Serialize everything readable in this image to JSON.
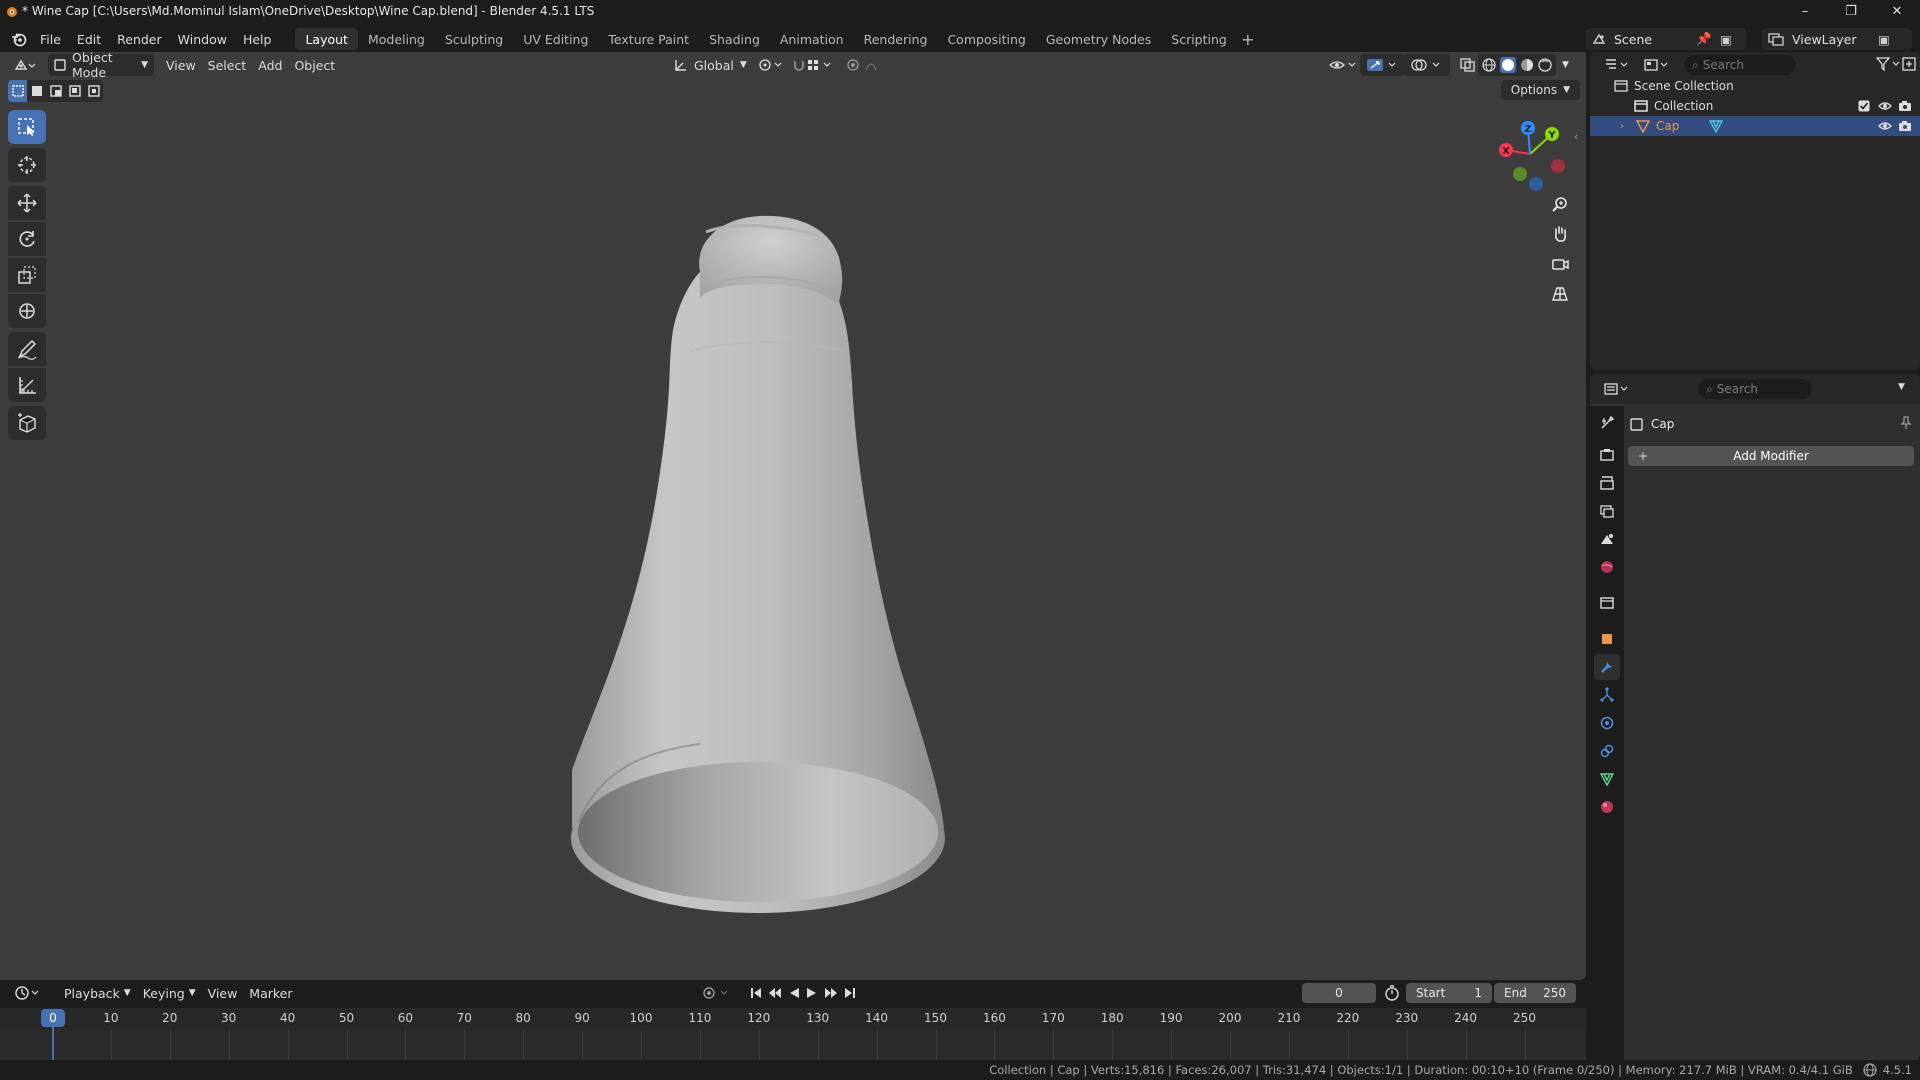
{
  "window": {
    "title": "* Wine Cap [C:\\Users\\Md.Mominul Islam\\OneDrive\\Desktop\\Wine Cap.blend] - Blender 4.5.1 LTS",
    "controls": [
      "–",
      "❐",
      "✕"
    ]
  },
  "menus": [
    "File",
    "Edit",
    "Render",
    "Window",
    "Help"
  ],
  "workspaces": {
    "tabs": [
      "Layout",
      "Modeling",
      "Sculpting",
      "UV Editing",
      "Texture Paint",
      "Shading",
      "Animation",
      "Rendering",
      "Compositing",
      "Geometry Nodes",
      "Scripting"
    ],
    "active": "Layout",
    "add": "+"
  },
  "scene": {
    "name": "Scene",
    "view_layer": "ViewLayer"
  },
  "viewport_header": {
    "mode": "Object Mode",
    "menus": [
      "View",
      "Select",
      "Add",
      "Object"
    ],
    "transform_orientation": "Global",
    "options": "Options"
  },
  "gizmo": {
    "x": "X",
    "y": "Y",
    "z": "Z",
    "x_color": "#ff3352",
    "y_color": "#8bdc00",
    "z_color": "#2890ff"
  },
  "timeline": {
    "menus": [
      "Playback",
      "Keying",
      "View",
      "Marker"
    ],
    "current_frame": "0",
    "start_label": "Start",
    "start": "1",
    "end_label": "End",
    "end": "250",
    "ruler": [
      "0",
      "10",
      "20",
      "30",
      "40",
      "50",
      "60",
      "70",
      "80",
      "90",
      "100",
      "110",
      "120",
      "130",
      "140",
      "150",
      "160",
      "170",
      "180",
      "190",
      "200",
      "210",
      "220",
      "230",
      "240",
      "250"
    ]
  },
  "status": {
    "text": "Collection | Cap | Verts:15,816 | Faces:26,007 | Tris:31,474 | Objects:1/1 | Duration: 00:10+10 (Frame 0/250) | Memory: 217.7 MiB | VRAM: 0.4/4.1 GiB",
    "version": "4.5.1"
  },
  "outliner": {
    "search_placeholder": "Search",
    "root": "Scene Collection",
    "collection": "Collection",
    "object": "Cap"
  },
  "properties": {
    "search_placeholder": "Search",
    "object_name": "Cap",
    "add_modifier": "Add Modifier"
  },
  "colors": {
    "accent": "#4772b3",
    "selected_row": "#334d80",
    "object_orange": "#e8974a",
    "mesh_cyan": "#4ec9e0"
  }
}
